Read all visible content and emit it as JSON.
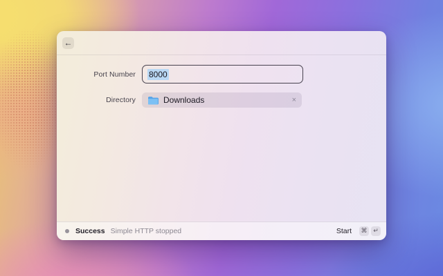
{
  "window": {
    "header": {
      "back_icon": "←"
    },
    "form": {
      "port": {
        "label": "Port Number",
        "value": "8000"
      },
      "directory": {
        "label": "Directory",
        "chip": {
          "icon": "blue-folder",
          "name": "Downloads",
          "remove": "×"
        }
      }
    },
    "footer": {
      "status": {
        "title": "Success",
        "message": "Simple HTTP stopped"
      },
      "action": {
        "label": "Start",
        "keys": [
          "⌘",
          "↵"
        ]
      }
    }
  },
  "colors": {
    "selection_highlight": "#b9d8f4",
    "input_border": "#47414e",
    "folder_blue_front": "#7cc0f4",
    "folder_blue_back": "#56a3e8",
    "status_dot": "#97939b"
  }
}
